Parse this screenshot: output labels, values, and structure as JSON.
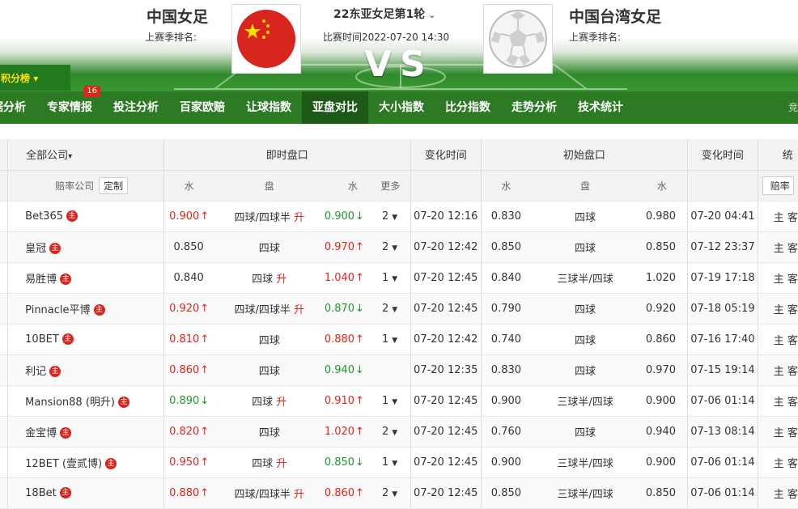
{
  "match": {
    "home_name": "中国女足",
    "home_rank_label": "上赛季排名:",
    "away_name": "中国台湾女足",
    "away_rank_label": "上赛季排名:",
    "league": "22东亚女足第1轮",
    "match_time": "比赛时间2022-07-20 14:30",
    "vs": "VS"
  },
  "standings_label": "积分榜",
  "nav": {
    "items": [
      {
        "label": "据分析"
      },
      {
        "label": "专家情报",
        "badge": "16"
      },
      {
        "label": "投注分析"
      },
      {
        "label": "百家欧赔"
      },
      {
        "label": "让球指数"
      },
      {
        "label": "亚盘对比",
        "active": true
      },
      {
        "label": "大小指数"
      },
      {
        "label": "比分指数"
      },
      {
        "label": "走势分析"
      },
      {
        "label": "技术统计"
      }
    ],
    "right_text": "竞"
  },
  "table": {
    "company_filter": "全部公司",
    "live_group": "即时盘口",
    "change_time": "变化时间",
    "initial_group": "初始盘口",
    "change_time2": "变化时间",
    "stats": "统",
    "sub_company": "赔率公司",
    "custom_btn": "定制",
    "sub_water": "水",
    "sub_line": "盘",
    "sub_water2": "水",
    "sub_more": "更多",
    "sub_iwater": "水",
    "sub_iline": "盘",
    "sub_iwater2": "水",
    "rate_btn": "赔率",
    "rows": [
      {
        "company": "Bet365",
        "w1": "0.900",
        "w1c": "red",
        "w1a": "↑",
        "line": "四球/四球半",
        "lineup": "升",
        "w2": "0.900",
        "w2c": "green",
        "w2a": "↓",
        "more": "2",
        "time": "07-20 12:16",
        "iw1": "0.830",
        "iline": "四球",
        "iw2": "0.980",
        "itime": "07-20 04:41",
        "stats": "主 客"
      },
      {
        "company": "皇冠",
        "w1": "0.850",
        "w1c": "",
        "w1a": "",
        "line": "四球",
        "lineup": "",
        "w2": "0.970",
        "w2c": "red",
        "w2a": "↑",
        "more": "2",
        "time": "07-20 12:42",
        "iw1": "0.850",
        "iline": "四球",
        "iw2": "0.850",
        "itime": "07-12 23:37",
        "stats": "主 客"
      },
      {
        "company": "易胜博",
        "w1": "0.840",
        "w1c": "",
        "w1a": "",
        "line": "四球",
        "lineup": "升",
        "w2": "1.040",
        "w2c": "red",
        "w2a": "↑",
        "more": "1",
        "time": "07-20 12:45",
        "iw1": "0.840",
        "iline": "三球半/四球",
        "iw2": "1.020",
        "itime": "07-19 17:18",
        "stats": "主 客"
      },
      {
        "company": "Pinnacle平博",
        "w1": "0.920",
        "w1c": "red",
        "w1a": "↑",
        "line": "四球/四球半",
        "lineup": "升",
        "w2": "0.870",
        "w2c": "green",
        "w2a": "↓",
        "more": "2",
        "time": "07-20 12:45",
        "iw1": "0.790",
        "iline": "四球",
        "iw2": "0.920",
        "itime": "07-18 05:19",
        "stats": "主 客"
      },
      {
        "company": "10BET",
        "w1": "0.810",
        "w1c": "red",
        "w1a": "↑",
        "line": "四球",
        "lineup": "",
        "w2": "0.880",
        "w2c": "red",
        "w2a": "↑",
        "more": "1",
        "time": "07-20 12:42",
        "iw1": "0.740",
        "iline": "四球",
        "iw2": "0.860",
        "itime": "07-16 17:40",
        "stats": "主 客"
      },
      {
        "company": "利记",
        "w1": "0.860",
        "w1c": "red",
        "w1a": "↑",
        "line": "四球",
        "lineup": "",
        "w2": "0.940",
        "w2c": "green",
        "w2a": "↓",
        "more": "",
        "time": "07-20 12:35",
        "iw1": "0.830",
        "iline": "四球",
        "iw2": "0.970",
        "itime": "07-15 19:14",
        "stats": "主 客"
      },
      {
        "company": "Mansion88 (明升)",
        "w1": "0.890",
        "w1c": "green",
        "w1a": "↓",
        "line": "四球",
        "lineup": "升",
        "w2": "0.910",
        "w2c": "red",
        "w2a": "↑",
        "more": "1",
        "time": "07-20 12:45",
        "iw1": "0.900",
        "iline": "三球半/四球",
        "iw2": "0.900",
        "itime": "07-06 01:14",
        "stats": "主 客"
      },
      {
        "company": "金宝博",
        "w1": "0.820",
        "w1c": "red",
        "w1a": "↑",
        "line": "四球",
        "lineup": "",
        "w2": "1.020",
        "w2c": "red",
        "w2a": "↑",
        "more": "2",
        "time": "07-20 12:45",
        "iw1": "0.760",
        "iline": "四球",
        "iw2": "0.940",
        "itime": "07-13 08:14",
        "stats": "主 客"
      },
      {
        "company": "12BET (壹贰博)",
        "w1": "0.950",
        "w1c": "red",
        "w1a": "↑",
        "line": "四球",
        "lineup": "升",
        "w2": "0.850",
        "w2c": "green",
        "w2a": "↓",
        "more": "1",
        "time": "07-20 12:45",
        "iw1": "0.900",
        "iline": "三球半/四球",
        "iw2": "0.900",
        "itime": "07-06 01:14",
        "stats": "主 客"
      },
      {
        "company": "18Bet",
        "w1": "0.880",
        "w1c": "red",
        "w1a": "↑",
        "line": "四球/四球半",
        "lineup": "升",
        "w2": "0.860",
        "w2c": "red",
        "w2a": "↑",
        "more": "2",
        "time": "07-20 12:45",
        "iw1": "0.850",
        "iline": "三球半/四球",
        "iw2": "0.850",
        "itime": "07-06 01:14",
        "stats": "主 客"
      }
    ],
    "master_glyph": "主"
  },
  "colors": {
    "red": "#e2231a",
    "green": "#1a9a2a",
    "nav_bg": "#2c7a24",
    "active_bg": "#1e5a17",
    "standings_text": "#ffe000"
  }
}
